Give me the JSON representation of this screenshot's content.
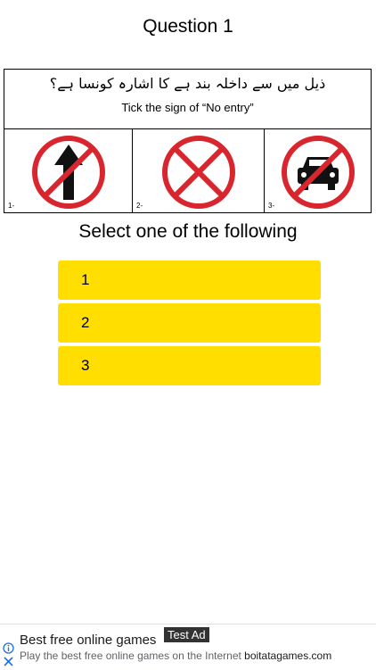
{
  "header": {
    "title": "Question 1"
  },
  "question": {
    "urdu_text": "ذیل میں سے داخلہ بند ہے کا اشارہ کونسا ہے؟",
    "english_text": "Tick the sign of “No entry”",
    "signs": [
      {
        "number": "1-",
        "icon": "no-overtaking-sign-icon"
      },
      {
        "number": "2-",
        "icon": "no-entry-sign-icon"
      },
      {
        "number": "3-",
        "icon": "no-cars-sign-icon"
      }
    ]
  },
  "prompt": "Select one of the following",
  "options": [
    "1",
    "2",
    "3"
  ],
  "colors": {
    "option_bg": "#FFDE00",
    "sign_red": "#D9262E"
  },
  "ad": {
    "title": "Best free online games",
    "badge": "Test Ad",
    "description_prefix": "Play the best free online games on the Internet",
    "domain": "boitatagames.com",
    "info_icon": "info-icon",
    "close_icon": "close-icon"
  }
}
